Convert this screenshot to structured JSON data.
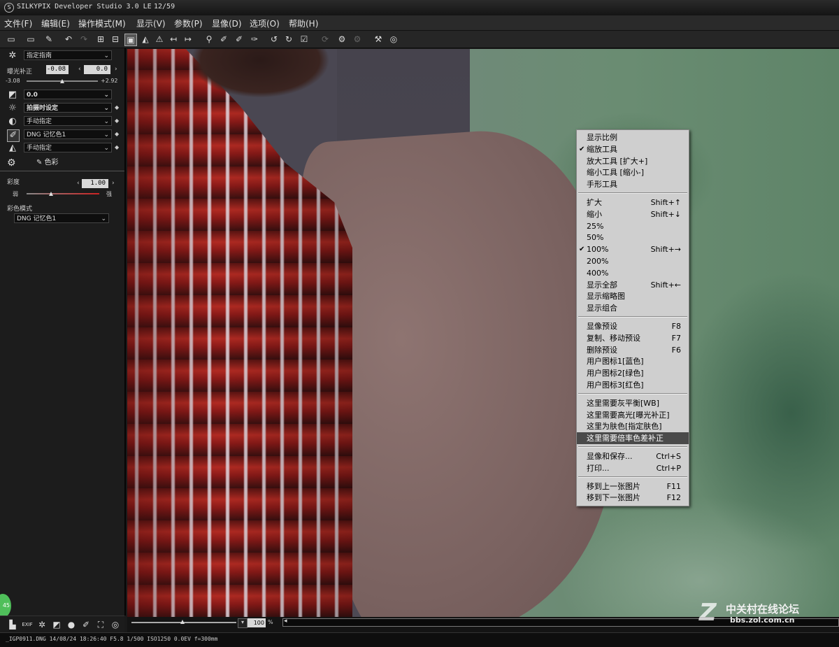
{
  "window": {
    "title": "SILKYPIX Developer Studio 3.0 LE",
    "image_counter": "12/59"
  },
  "menubar": [
    "文件(F)",
    "编辑(E)",
    "操作模式(M)",
    "显示(V)",
    "参数(P)",
    "显像(D)",
    "选项(O)",
    "帮助(H)"
  ],
  "toolbar_icons": [
    "open-folder-icon",
    "open-folder-2-icon",
    "stamp-icon",
    "undo-icon",
    "redo-icon",
    "grid-view-icon",
    "split-view-icon",
    "single-view-icon",
    "sharpen-icon",
    "warning-icon",
    "prev-arrow-icon",
    "next-arrow-icon",
    "zoom-icon",
    "pipette-wb-icon",
    "pipette-gray-icon",
    "pipette-skin-icon",
    "rotate-left-icon",
    "rotate-right-icon",
    "check-icon",
    "refresh-icon",
    "develop-icon",
    "develop-all-icon",
    "hammer-icon",
    "target-icon"
  ],
  "sidebar": {
    "taste_dropdown": "指定指南",
    "exposure": {
      "label": "曝光补正",
      "value": "-0.08",
      "value2": "0.0",
      "min": "-3.08",
      "max": "+2.92",
      "level": 0.5
    },
    "tone_dropdown": "0.0",
    "wb_dropdown": "拍摄时设定",
    "contrast_dropdown": "手动指定",
    "color_dropdown": "DNG 记忆色1",
    "sharpness_dropdown": "手动指定",
    "tab_color": "色彩",
    "saturation": {
      "label": "彩度",
      "value": "1.00",
      "weak": "弱",
      "strong": "强",
      "level": 0.5
    },
    "color_mode_label": "彩色模式",
    "color_mode_value": "DNG 记忆色1"
  },
  "context_menu": {
    "items": [
      {
        "label": "显示比例",
        "shortcut": "",
        "checked": false
      },
      {
        "label": "缩放工具",
        "shortcut": "",
        "checked": true
      },
      {
        "label": "放大工具 [扩大+]",
        "shortcut": "",
        "checked": false
      },
      {
        "label": "缩小工具 [缩小-]",
        "shortcut": "",
        "checked": false
      },
      {
        "label": "手形工具",
        "shortcut": "",
        "checked": false
      },
      {
        "sep": true
      },
      {
        "label": "扩大",
        "shortcut": "Shift+↑",
        "checked": false
      },
      {
        "label": "缩小",
        "shortcut": "Shift+↓",
        "checked": false
      },
      {
        "label": "25%",
        "shortcut": "",
        "checked": false
      },
      {
        "label": "50%",
        "shortcut": "",
        "checked": false
      },
      {
        "label": "100%",
        "shortcut": "Shift+→",
        "checked": true
      },
      {
        "label": "200%",
        "shortcut": "",
        "checked": false
      },
      {
        "label": "400%",
        "shortcut": "",
        "checked": false
      },
      {
        "label": "显示全部",
        "shortcut": "Shift+←",
        "checked": false
      },
      {
        "label": "显示缩略图",
        "shortcut": "",
        "checked": false
      },
      {
        "label": "显示组合",
        "shortcut": "",
        "checked": false
      },
      {
        "sep": true
      },
      {
        "label": "显像预设",
        "shortcut": "F8",
        "checked": false
      },
      {
        "label": "复制、移动预设",
        "shortcut": "F7",
        "checked": false
      },
      {
        "label": "删除预设",
        "shortcut": "F6",
        "checked": false
      },
      {
        "label": "用户图标1[蓝色]",
        "shortcut": "",
        "checked": false
      },
      {
        "label": "用户图标2[绿色]",
        "shortcut": "",
        "checked": false
      },
      {
        "label": "用户图标3[红色]",
        "shortcut": "",
        "checked": false
      },
      {
        "sep": true
      },
      {
        "label": "这里需要灰平衡[WB]",
        "shortcut": "",
        "checked": false
      },
      {
        "label": "这里需要高光[曝光补正]",
        "shortcut": "",
        "checked": false
      },
      {
        "label": "这里为肤色[指定肤色]",
        "shortcut": "",
        "checked": false
      },
      {
        "label": "这里需要倍率色差补正",
        "shortcut": "",
        "checked": false,
        "highlighted": true
      },
      {
        "sep": true
      },
      {
        "label": "显像和保存...",
        "shortcut": "Ctrl+S",
        "checked": false
      },
      {
        "label": "打印...",
        "shortcut": "Ctrl+P",
        "checked": false
      },
      {
        "sep": true
      },
      {
        "label": "移到上一张图片",
        "shortcut": "F11",
        "checked": false
      },
      {
        "label": "移到下一张图片",
        "shortcut": "F12",
        "checked": false
      }
    ]
  },
  "zoom": {
    "value": "100",
    "unit": "%"
  },
  "status": "_IGP0911.DNG 14/08/24 18:26:40 F5.8 1/500 ISO1250 0.0EV f=300mm",
  "watermark": {
    "line1": "中关村在线论坛",
    "line2": "bbs.zol.com.cn",
    "badge": "45"
  },
  "colors": {
    "menu_bg": "#cfcfcf",
    "menu_highlight": "#4a4a4a",
    "app_bg": "#1c1c1c"
  }
}
